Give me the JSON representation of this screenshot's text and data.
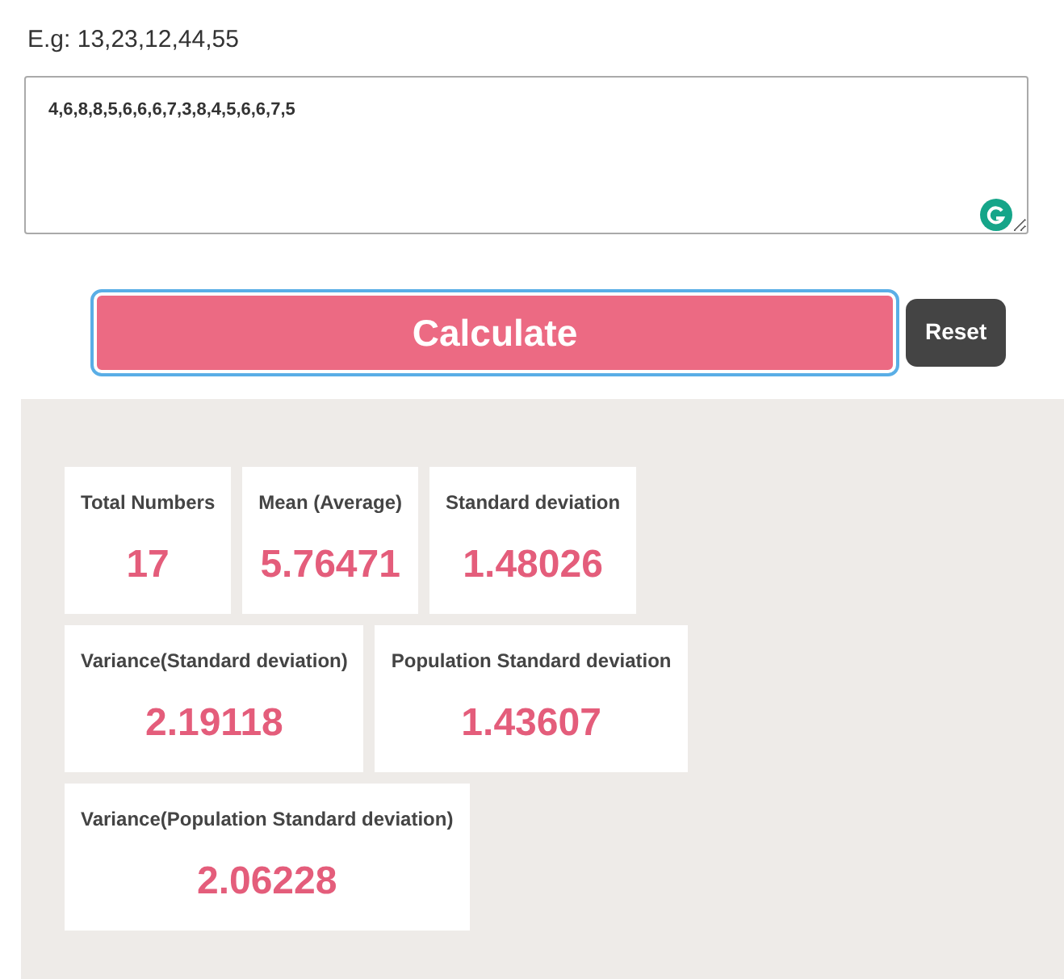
{
  "hint": "E.g: 13,23,12,44,55",
  "input": {
    "value": "4,6,8,8,5,6,6,6,7,3,8,4,5,6,6,7,5"
  },
  "buttons": [
    {
      "kind": "primary",
      "label": "Calculate"
    },
    {
      "kind": "secondary",
      "label": "Reset"
    }
  ],
  "results": [
    [
      {
        "label": "Total Numbers",
        "value": "17"
      },
      {
        "label": "Mean (Average)",
        "value": "5.76471"
      },
      {
        "label": "Standard deviation",
        "value": "1.48026"
      }
    ],
    [
      {
        "label": "Variance(Standard deviation)",
        "value": "2.19118"
      },
      {
        "label": "Population Standard deviation",
        "value": "1.43607"
      }
    ],
    [
      {
        "label": "Variance(Population Standard deviation)",
        "value": "2.06228"
      }
    ]
  ]
}
